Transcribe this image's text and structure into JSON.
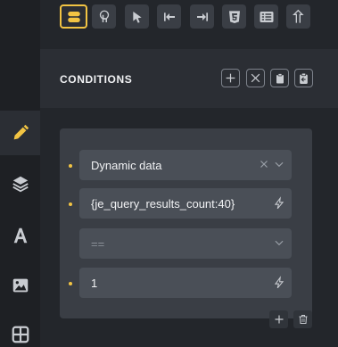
{
  "conditions": {
    "title": "CONDITIONS",
    "rows": [
      {
        "type": "select",
        "value": "Dynamic data",
        "icons": [
          "clear-icon",
          "chevron-down-icon"
        ]
      },
      {
        "type": "text",
        "value": "{je_query_results_count:40}",
        "icons": [
          "dynamic-data-icon"
        ]
      },
      {
        "type": "select",
        "value": "==",
        "placeholder": true,
        "icons": [
          "chevron-down-icon"
        ]
      },
      {
        "type": "text",
        "value": "1",
        "icons": [
          "dynamic-data-icon"
        ]
      }
    ]
  },
  "toolbar": {
    "icons": [
      "toggle-icon",
      "touch-icon",
      "pointer-icon",
      "step-back-icon",
      "step-forward-icon",
      "css-icon",
      "list-icon",
      "upload-icon"
    ]
  },
  "header_actions": [
    "add-icon",
    "close-icon",
    "clipboard-icon",
    "paste-icon"
  ],
  "sidebar": {
    "items": [
      "pencil-icon",
      "layers-icon",
      "typography-icon",
      "image-icon",
      "grid-icon"
    ],
    "active": "pencil-icon"
  },
  "colors": {
    "accent": "#f2c443",
    "panel": "#2b2e34",
    "card": "#3a3e45",
    "field": "#4a4f57"
  }
}
